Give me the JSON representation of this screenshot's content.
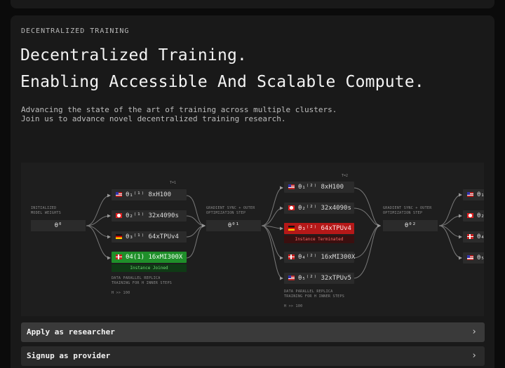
{
  "section": {
    "eyebrow": "DECENTRALIZED TRAINING",
    "headline_line1": "Decentralized Training.",
    "headline_line2": "Enabling Accessible And Scalable Compute.",
    "description_line1": "Advancing the state of the art of training across multiple clusters.",
    "description_line2": "Join us to advance novel decentralized training research."
  },
  "diagram": {
    "t1_label": "T=1",
    "t2_label": "T=2",
    "init_label": "INITIALIZED\nMODEL WEIGHTS",
    "init_theta": "θ⁰",
    "sync_label_1": "GRADIENT SYNC + OUTER\nOPTIMIZATION STEP",
    "sync_theta_1": "θ⁰¹",
    "sync_label_2": "GRADIENT SYNC + OUTER\nOPTIMIZATION STEP",
    "sync_theta_2": "θ⁰²",
    "replica_note_1": "DATA PARALLEL REPLICA\nTRAINING FOR H INNER STEPS",
    "h_note_1": "H >> 100",
    "replica_note_2": "DATA PARALLEL REPLICA\nTRAINING FOR H INNER STEPS",
    "h_note_2": "H >> 100",
    "col1": [
      {
        "flag": "us",
        "label": "θ₁⁽¹⁾ 8xH100"
      },
      {
        "flag": "ch",
        "label": "θ₂⁽¹⁾ 32x4090s"
      },
      {
        "flag": "de",
        "label": "θ₃⁽¹⁾ 64xTPUv4"
      },
      {
        "flag": "dk",
        "label": "θ4(1) 16xMI300X",
        "status": "Instance Joined"
      }
    ],
    "col2": [
      {
        "flag": "us",
        "label": "θ₁⁽²⁾ 8xH100"
      },
      {
        "flag": "ch",
        "label": "θ₂⁽²⁾ 32x4090s"
      },
      {
        "flag": "de",
        "label": "θ₃⁽²⁾ 64xTPUv4",
        "status": "Instance Terminated"
      },
      {
        "flag": "dk",
        "label": "θ₄⁽²⁾ 16xMI300X"
      },
      {
        "flag": "us",
        "label": "θ₅⁽²⁾ 32xTPUv5"
      }
    ],
    "col3": [
      {
        "flag": "us",
        "label": "θ₁"
      },
      {
        "flag": "ch",
        "label": "θ₂"
      },
      {
        "flag": "dk",
        "label": "θ₄⁽"
      },
      {
        "flag": "us",
        "label": "θ₅"
      }
    ]
  },
  "actions": {
    "apply_label": "Apply as researcher",
    "signup_label": "Signup as provider",
    "chevron": "›"
  }
}
